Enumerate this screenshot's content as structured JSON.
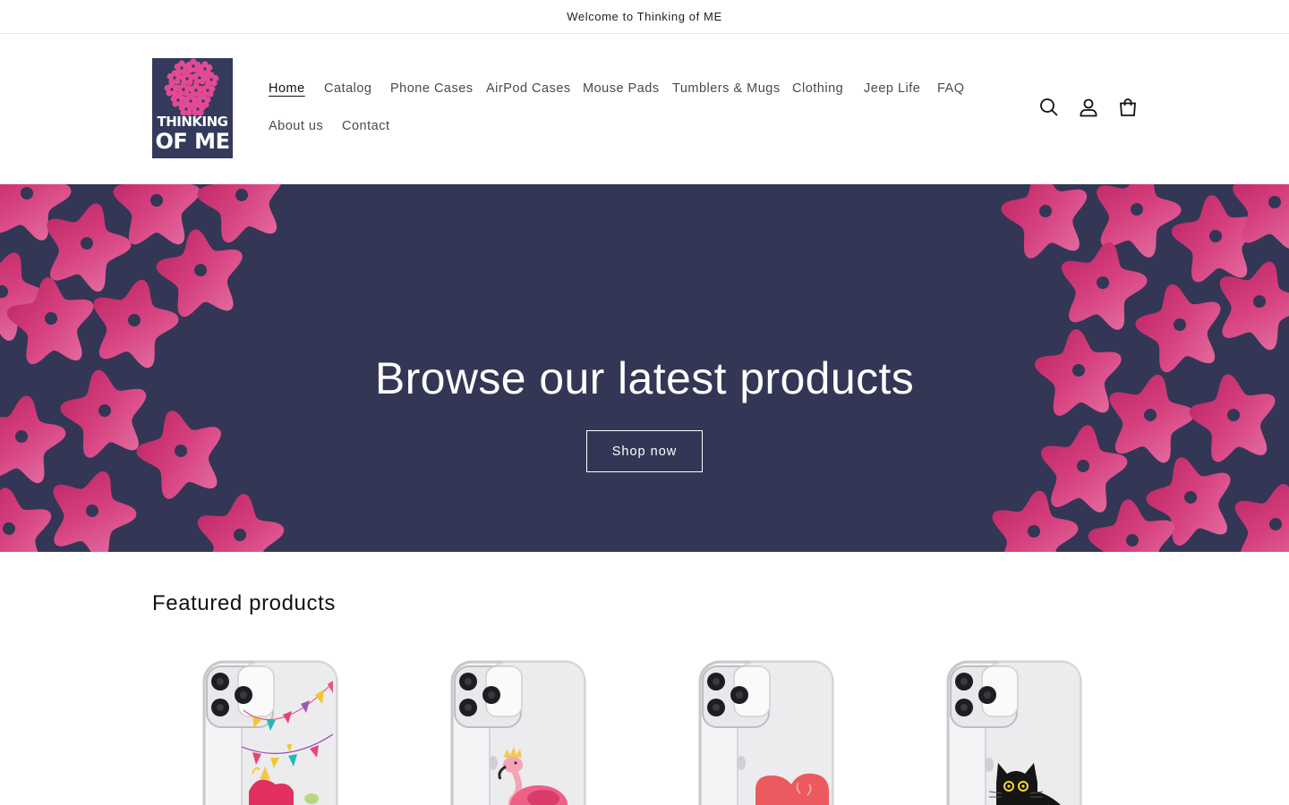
{
  "announcement": {
    "text": "Welcome to Thinking of ME"
  },
  "logo": {
    "line1": "THINKING",
    "line2": "OF ME",
    "bg_color": "#343a5c",
    "flower_color": "#e24a93"
  },
  "nav": {
    "items": [
      {
        "label": "Home",
        "active": true
      },
      {
        "label": "Catalog"
      },
      {
        "label": "Phone Cases"
      },
      {
        "label": "AirPod Cases"
      },
      {
        "label": "Mouse Pads"
      },
      {
        "label": "Tumblers & Mugs"
      },
      {
        "label": "Clothing"
      },
      {
        "label": "Jeep Life"
      },
      {
        "label": "FAQ"
      },
      {
        "label": "About us"
      },
      {
        "label": "Contact"
      }
    ]
  },
  "header_icons": [
    "search-icon",
    "account-icon",
    "cart-icon"
  ],
  "hero": {
    "title": "Browse our latest products",
    "button_label": "Shop now",
    "bg_color": "#333654",
    "flower_color": "#d6407f"
  },
  "featured": {
    "title": "Featured products",
    "products": [
      {
        "design": "party-bunting-dinosaur"
      },
      {
        "design": "flamingo-with-crown"
      },
      {
        "design": "red-heart"
      },
      {
        "design": "black-cat"
      }
    ]
  }
}
